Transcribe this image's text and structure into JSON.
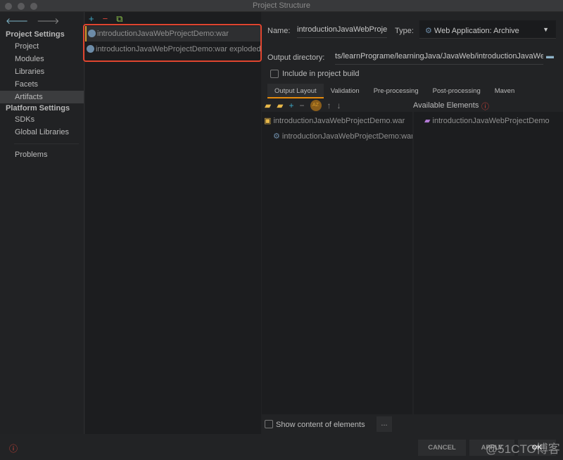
{
  "window": {
    "title": "Project Structure"
  },
  "sidebar": {
    "project_settings": "Project Settings",
    "items": [
      "Project",
      "Modules",
      "Libraries",
      "Facets",
      "Artifacts"
    ],
    "platform_settings": "Platform Settings",
    "platform_items": [
      "SDKs",
      "Global Libraries"
    ],
    "problems": "Problems"
  },
  "artifacts": {
    "items": [
      "introductionJavaWebProjectDemo:war",
      "introductionJavaWebProjectDemo:war exploded"
    ]
  },
  "form": {
    "name_label": "Name:",
    "name_value": "introductionJavaWebProjectDemo:war",
    "type_label": "Type:",
    "type_value": "Web Application: Archive",
    "output_label": "Output directory:",
    "output_value": "ts/learnPrograme/learningJava/JavaWeb/introductionJavaWeb",
    "include_label": "Include in project build",
    "include_checked": false
  },
  "tabs": [
    "Output Layout",
    "Validation",
    "Pre-processing",
    "Post-processing",
    "Maven"
  ],
  "layout": {
    "available_label": "Available Elements",
    "tree": [
      "introductionJavaWebProjectDemo.war",
      "introductionJavaWebProjectDemo:war"
    ],
    "available": [
      "introductionJavaWebProjectDemo"
    ],
    "show_content_label": "Show content of elements",
    "more_label": "..."
  },
  "buttons": {
    "cancel": "CANCEL",
    "apply": "APPLY",
    "ok": "OK"
  },
  "watermark": "@51CTO博客",
  "colors": {
    "accent": "#e58a0c",
    "highlight": "#e0452f"
  }
}
